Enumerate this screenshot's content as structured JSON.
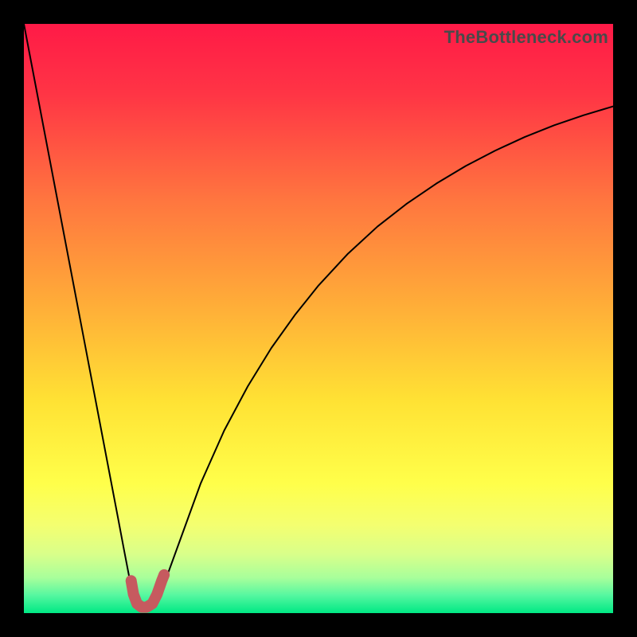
{
  "watermark": "TheBottleneck.com",
  "colors": {
    "curve": "#000000",
    "marker": "#c65a5f",
    "gradient_top": "#ff1a47",
    "gradient_mid": "#ffe234",
    "gradient_bottom": "#00e884"
  },
  "chart_data": {
    "type": "line",
    "title": "",
    "xlabel": "",
    "ylabel": "",
    "xlim": [
      0,
      100
    ],
    "ylim": [
      0,
      100
    ],
    "legend": false,
    "grid": false,
    "background": "rainbow-vertical",
    "series": [
      {
        "name": "bottleneck-curve",
        "role": "main",
        "color": "#000000",
        "x": [
          0,
          2,
          4,
          6,
          8,
          10,
          12,
          14,
          16,
          17,
          18,
          19,
          20,
          21,
          22,
          23,
          24,
          26,
          28,
          30,
          34,
          38,
          42,
          46,
          50,
          55,
          60,
          65,
          70,
          75,
          80,
          85,
          90,
          95,
          100
        ],
        "y": [
          100,
          89.5,
          79,
          68.5,
          58,
          47.5,
          37,
          26.5,
          16,
          10.7,
          5.5,
          2.7,
          1.3,
          1.0,
          1.3,
          2.7,
          5.5,
          11,
          16.5,
          22,
          31,
          38.5,
          45,
          50.6,
          55.6,
          61.0,
          65.6,
          69.5,
          72.9,
          75.9,
          78.5,
          80.8,
          82.8,
          84.5,
          86.0
        ]
      },
      {
        "name": "optimal-marker",
        "role": "overlay",
        "color": "#c65a5f",
        "stroke_width": 14,
        "x": [
          18.2,
          18.6,
          19.2,
          20.0,
          20.8,
          21.8,
          22.6,
          23.4,
          23.8
        ],
        "y": [
          5.5,
          3.2,
          1.6,
          1.0,
          1.0,
          1.6,
          3.2,
          5.5,
          6.5
        ]
      }
    ],
    "annotations": [
      {
        "type": "watermark",
        "text": "TheBottleneck.com",
        "position": "top-right"
      }
    ]
  }
}
